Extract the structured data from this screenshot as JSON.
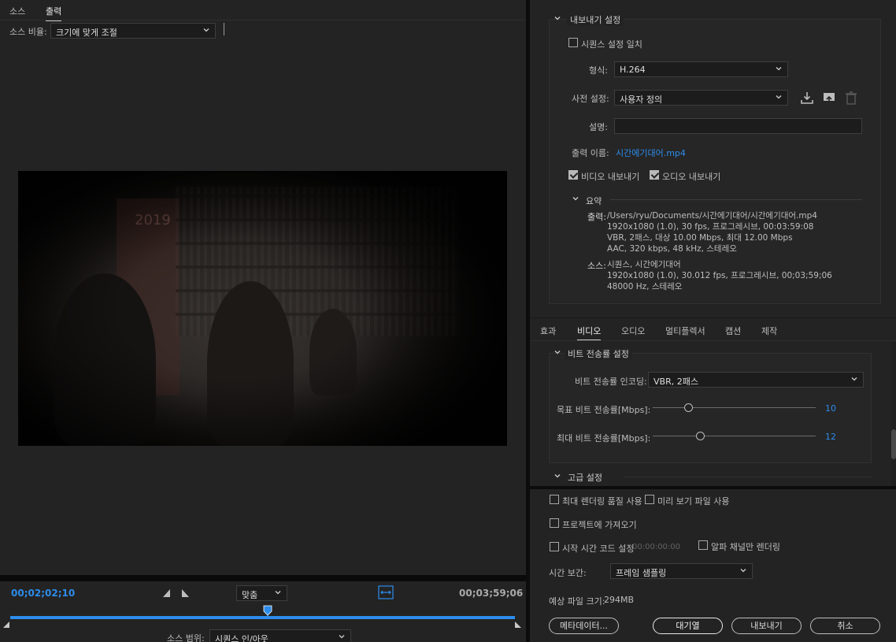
{
  "left": {
    "tabs": [
      "소스",
      "출력"
    ],
    "active_tab": "출력",
    "source_scaling_label": "소스 비율:",
    "source_scaling_value": "크기에 맞게 조절",
    "current_time": "00;02;02;10",
    "duration": "00;03;59;06",
    "zoom_value": "맞춤",
    "source_range_label": "소스 범위:",
    "source_range_value": "시퀀스 인/아웃",
    "video_poster_text": "2019"
  },
  "export_settings": {
    "section_title": "내보내기 설정",
    "match_sequence_label": "시퀀스 설정 일치",
    "match_sequence_checked": false,
    "format_label": "형식:",
    "format_value": "H.264",
    "preset_label": "사전 설정:",
    "preset_value": "사용자 정의",
    "comments_label": "설명:",
    "comments_value": "",
    "output_name_label": "출력 이름:",
    "output_name_value": "시간에기대어.mp4",
    "export_video_label": "비디오 내보내기",
    "export_video_checked": true,
    "export_audio_label": "오디오 내보내기",
    "export_audio_checked": true,
    "summary_title": "요약",
    "summary_output_label": "출력:",
    "summary_output_lines": [
      "/Users/ryu/Documents/시간에기대어/시간에기대어.mp4",
      "1920x1080 (1.0), 30 fps, 프로그레시브, 00:03:59:08",
      "VBR, 2패스, 대상 10.00 Mbps, 최대 12.00 Mbps",
      "AAC, 320 kbps, 48 kHz, 스테레오"
    ],
    "summary_source_label": "소스:",
    "summary_source_lines": [
      "시퀀스, 시간에기대어",
      "1920x1080 (1.0), 30.012 fps, 프로그레시브, 00;03;59;06",
      "48000 Hz, 스테레오"
    ]
  },
  "settings_tabs": [
    "효과",
    "비디오",
    "오디오",
    "멀티플렉서",
    "캡션",
    "제작"
  ],
  "active_settings_tab": "비디오",
  "bitrate": {
    "section_title": "비트 전송률 설정",
    "encoding_label": "비트 전송률 인코딩:",
    "encoding_value": "VBR, 2패스",
    "target_label": "목표 비트 전송률[Mbps]:",
    "target_value": "10",
    "target_fraction": 0.04,
    "max_label": "최대 비트 전송률[Mbps]:",
    "max_value": "12",
    "max_fraction": 0.055
  },
  "advanced": {
    "section_title": "고급 설정"
  },
  "options": {
    "max_render_quality": "최대 렌더링 품질 사용",
    "use_previews": "미리 보기 파일 사용",
    "import_into_project": "프로젝트에 가져오기",
    "set_start_timecode": "시작 시간 코드 설정",
    "start_timecode_value": "00:00:00:00",
    "render_alpha_only": "알파 채널만 렌더링",
    "time_interpolation_label": "시간 보간:",
    "time_interpolation_value": "프레임 샘플링",
    "estimated_size_label": "예상 파일 크기:",
    "estimated_size_value": "294MB"
  },
  "buttons": {
    "metadata": "메타데이터...",
    "queue": "대기열",
    "export": "내보내기",
    "cancel": "취소"
  },
  "colors": {
    "accent_blue": "#2d8ceb",
    "panel_bg": "#232323"
  }
}
